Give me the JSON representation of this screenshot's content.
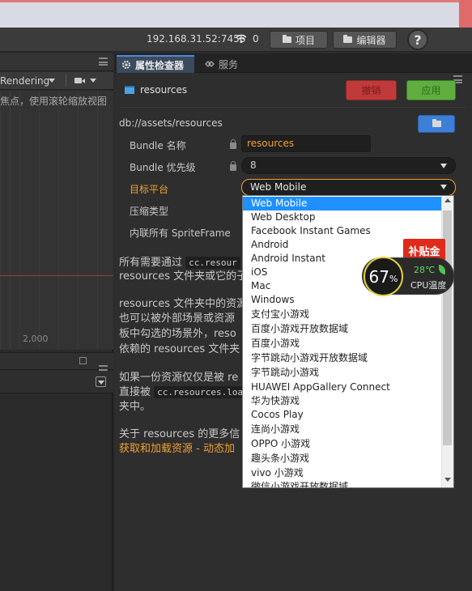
{
  "topbar": {
    "ip": "192.168.31.52:7456",
    "connections": "0",
    "project_label": "项目",
    "editor_label": "编辑器",
    "help_label": "?"
  },
  "scene": {
    "render_mode": "Rendering",
    "hint": "焦点，使用滚轮缩放视图",
    "axis_label": "2,000"
  },
  "inspector": {
    "tab_inspector": "属性检查器",
    "tab_services": "服务",
    "asset_name": "resources",
    "revert_label": "撤销",
    "apply_label": "应用",
    "path": "db://assets/resources",
    "props": {
      "bundle_name_label": "Bundle 名称",
      "bundle_name_value": "resources",
      "priority_label": "Bundle 优先级",
      "priority_value": "8",
      "platform_label": "目标平台",
      "platform_value": "Web Mobile",
      "compression_label": "压缩类型",
      "inline_label": "内联所有 SpriteFrame"
    },
    "description": {
      "p1_line1": "所有需要通过",
      "p1_code": "cc.resour",
      "p1_line2": "resources 文件夹或它的子",
      "p2_line1": "resources 文件夹中的资源",
      "p2_line2": "也可以被外部场景或资源",
      "p2_line3": "板中勾选的场景外，reso",
      "p2_line4": "依赖的 resources 文件夹",
      "p3_line1": "如果一份资源仅仅是被 re",
      "p3_line2": "直接被",
      "p3_code": "cc.resources.loa",
      "p3_line3": "夹中。",
      "p4_line1": "关于 resources 的更多信",
      "p4_link": "获取和加载资源 - 动态加"
    }
  },
  "dropdown": {
    "options": [
      "Web Mobile",
      "Web Desktop",
      "Facebook Instant Games",
      "Android",
      "Android Instant",
      "iOS",
      "Mac",
      "Windows",
      "支付宝小游戏",
      "百度小游戏开放数据域",
      "百度小游戏",
      "字节跳动小游戏开放数据域",
      "字节跳动小游戏",
      "HUAWEI AppGallery Connect",
      "华为快游戏",
      "Cocos Play",
      "连尚小游戏",
      "OPPO 小游戏",
      "趣头条小游戏",
      "vivo 小游戏",
      "微信小游戏开放数据域"
    ],
    "selected": "Web Mobile"
  },
  "overlay": {
    "subsidy_label": "补贴金",
    "cpu_percent": "67",
    "cpu_percent_sign": "%",
    "cpu_temp": "28℃",
    "cpu_label": "CPU温度"
  },
  "colors": {
    "accent_orange": "#f0a030",
    "selection_blue": "#1e90ff",
    "revert_red": "#c03a3a",
    "apply_green": "#5fae3f"
  }
}
